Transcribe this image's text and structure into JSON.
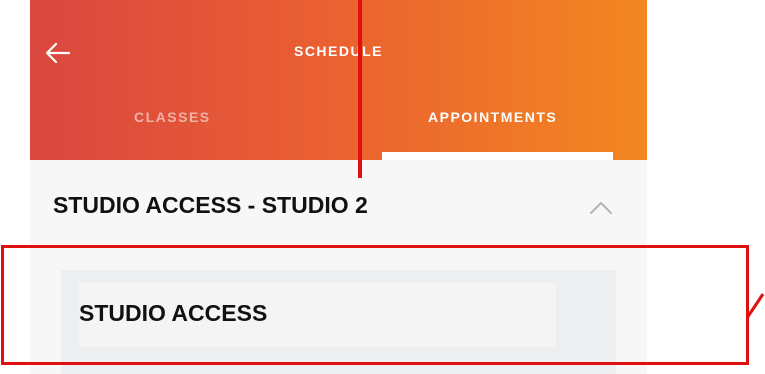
{
  "header": {
    "title": "SCHEDULE",
    "back_icon": "arrow-left-icon",
    "gradient": [
      "#d9473f",
      "#f38720"
    ]
  },
  "tabs": [
    {
      "label": "CLASSES",
      "active": false
    },
    {
      "label": "APPOINTMENTS",
      "active": true
    }
  ],
  "section": {
    "title": "STUDIO ACCESS - STUDIO 2",
    "expanded": true,
    "chevron_icon": "chevron-up-icon"
  },
  "items": [
    {
      "label": "STUDIO ACCESS"
    }
  ],
  "annotation": {
    "color": "#e01010"
  }
}
